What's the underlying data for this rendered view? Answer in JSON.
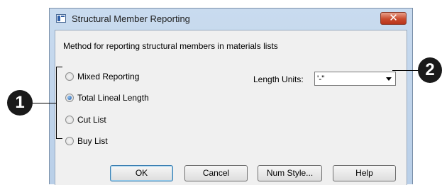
{
  "dialog": {
    "title": "Structural Member Reporting",
    "close_glyph": "✕"
  },
  "method": {
    "label": "Method for reporting structural members in materials lists",
    "options": [
      {
        "label": "Mixed Reporting",
        "checked": false
      },
      {
        "label": "Total Lineal Length",
        "checked": true
      },
      {
        "label": "Cut List",
        "checked": false
      },
      {
        "label": "Buy List",
        "checked": false
      }
    ]
  },
  "length_units": {
    "label": "Length Units:",
    "value": "'-\""
  },
  "buttons": {
    "ok": "OK",
    "cancel": "Cancel",
    "num_style": "Num Style...",
    "help": "Help"
  },
  "callouts": {
    "one": "1",
    "two": "2"
  },
  "colors": {
    "close_button": "#c94b2e",
    "radio_selected": "#1b58a8",
    "callout": "#1a1a1a"
  }
}
